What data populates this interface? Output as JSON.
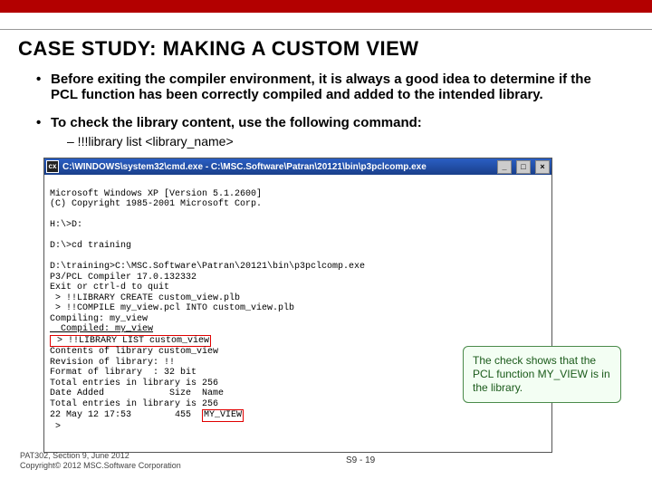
{
  "title": "CASE STUDY: MAKING A CUSTOM VIEW",
  "bullets": {
    "b1": "Before exiting the compiler environment, it is always a good idea to determine if the PCL function has been correctly compiled and added to the intended library.",
    "b2": "To check the library content, use the following command:",
    "sub1": "– !!!library list <library_name>"
  },
  "cmdwin": {
    "icon": "cx",
    "title": "C:\\WINDOWS\\system32\\cmd.exe - C:\\MSC.Software\\Patran\\20121\\bin\\p3pclcomp.exe",
    "lines": {
      "l1": "Microsoft Windows XP [Version 5.1.2600]",
      "l2": "(C) Copyright 1985-2001 Microsoft Corp.",
      "l3": "",
      "l4": "H:\\>D:",
      "l5": "",
      "l6": "D:\\>cd training",
      "l7": "",
      "l8": "D:\\training>C:\\MSC.Software\\Patran\\20121\\bin\\p3pclcomp.exe",
      "l9": "P3/PCL Compiler 17.0.132332",
      "l10": "Exit or ctrl-d to quit",
      "l11": " > !!LIBRARY CREATE custom_view.plb",
      "l12": " > !!COMPILE my_view.pcl INTO custom_view.plb",
      "l13": "Compiling: my_view",
      "l14_a": "  Compiled: my_view",
      "l15_red": " > !!LIBRARY LIST custom_view",
      "l16": "Contents of library custom_view",
      "l17": "Revision of library: !!",
      "l18": "Format of library  : 32 bit",
      "l19": "Total entries in library is 256",
      "l20": "Date Added            Size  Name",
      "l21": "Total entries in library is 256",
      "l22_a": "22 May 12 17:53        455  ",
      "l22_red": "MY_VIEW",
      "l23": " >"
    }
  },
  "callout": "The check shows that the PCL function MY_VIEW is in the library.",
  "footer": {
    "l1": "PAT302, Section 9, June 2012",
    "l2": "Copyright© 2012 MSC.Software Corporation"
  },
  "pagenum": "S9 - 19"
}
